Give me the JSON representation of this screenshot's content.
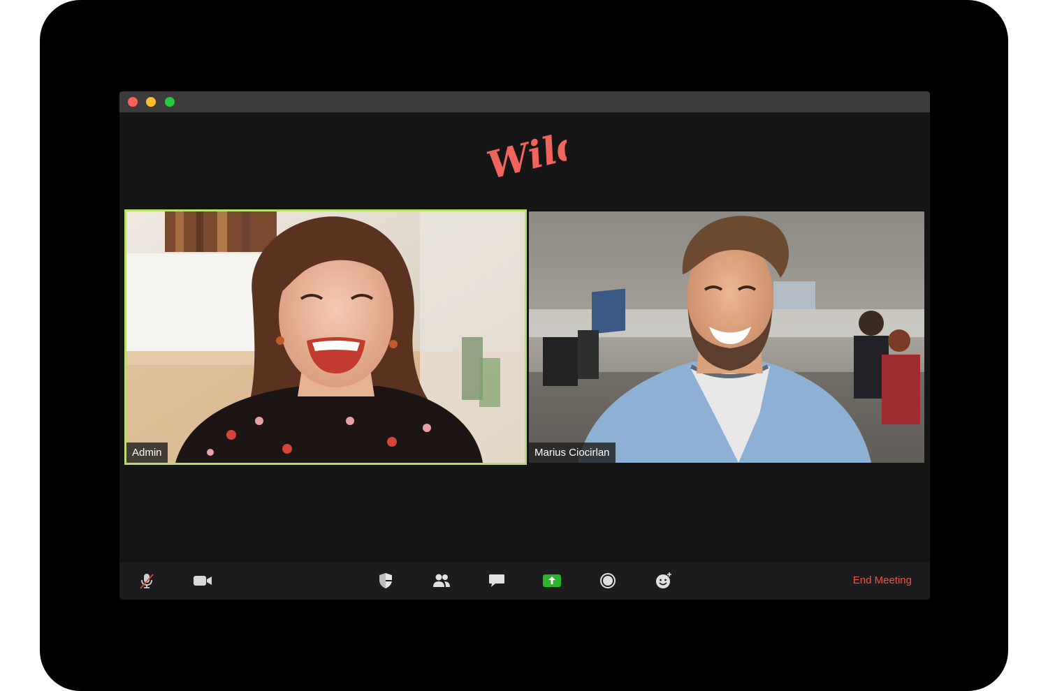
{
  "brand": {
    "logo_text": "Wild",
    "logo_color": "#f0645e"
  },
  "window": {
    "traffic_lights": [
      "close",
      "minimize",
      "zoom"
    ]
  },
  "participants": [
    {
      "name": "Admin",
      "active_speaker": true,
      "highlight_color": "#b8df6b"
    },
    {
      "name": "Marius Ciocirlan",
      "active_speaker": false
    }
  ],
  "toolbar": {
    "icons": [
      "muted-mic-icon",
      "video-camera-icon",
      "security-shield-icon",
      "participants-icon",
      "chat-icon",
      "share-screen-icon",
      "record-icon",
      "reactions-icon"
    ],
    "share_color": "#2bb32b",
    "end_label": "End Meeting",
    "end_color": "#f0524b"
  }
}
